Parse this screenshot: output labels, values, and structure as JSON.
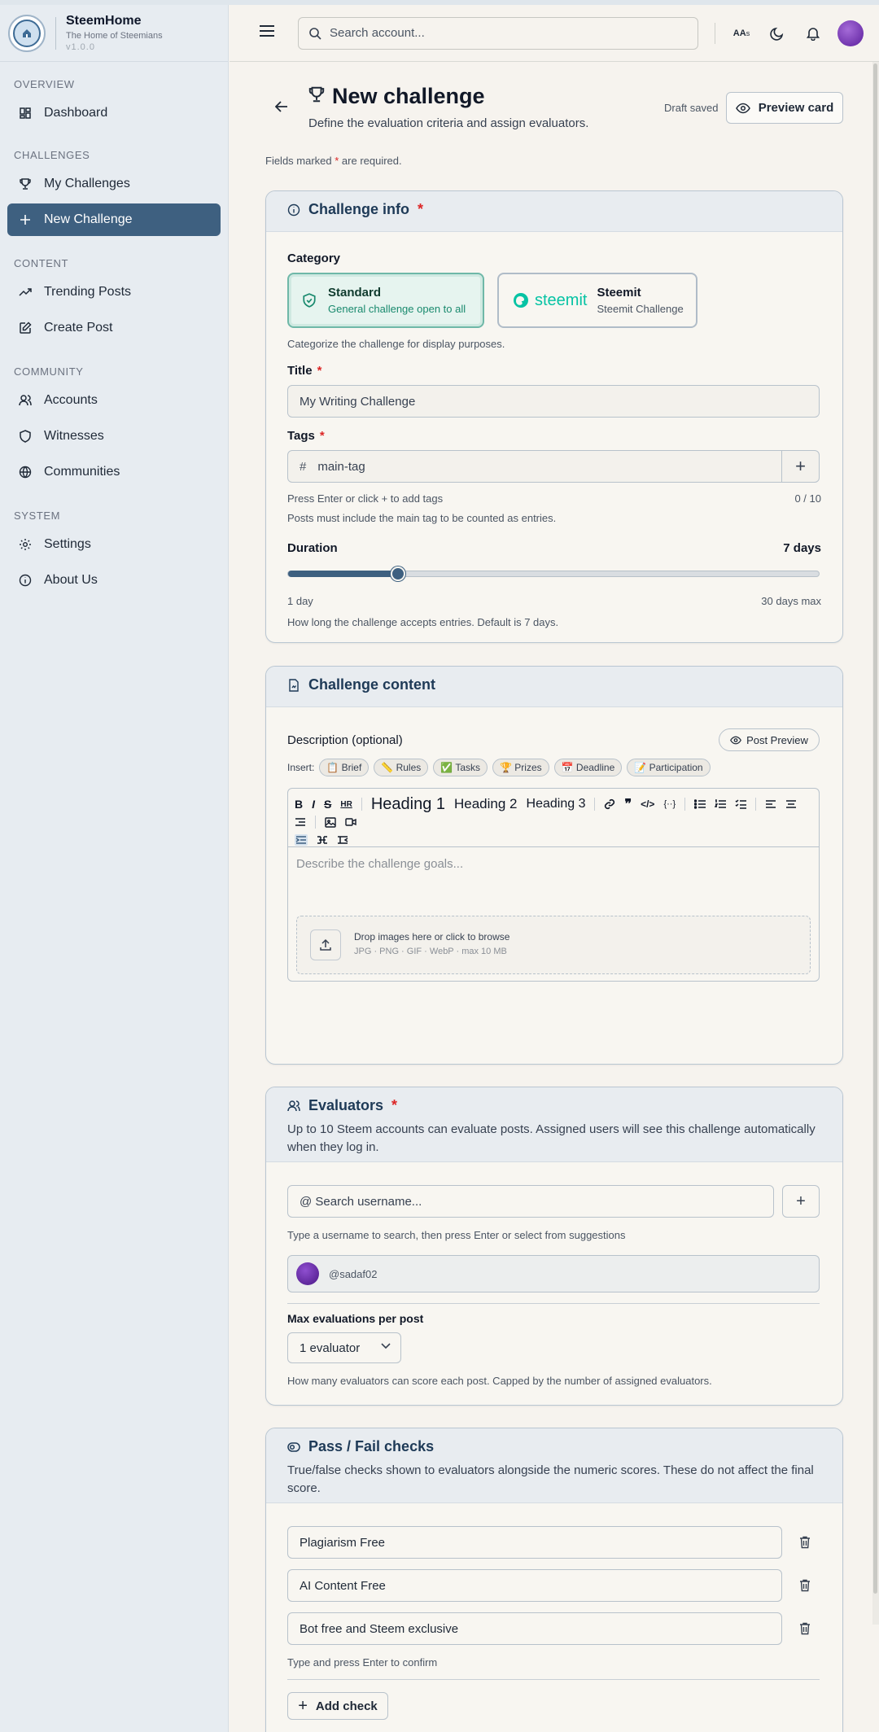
{
  "app": {
    "name": "SteemHome",
    "tagline": "The Home of Steemians",
    "version": "v1.0.0"
  },
  "sidebar": {
    "sections": [
      {
        "title": "OVERVIEW",
        "items": [
          {
            "label": "Dashboard",
            "icon": "dashboard-icon"
          }
        ]
      },
      {
        "title": "CHALLENGES",
        "items": [
          {
            "label": "My Challenges",
            "icon": "trophy-icon"
          },
          {
            "label": "New Challenge",
            "icon": "plus-icon",
            "active": true
          }
        ]
      },
      {
        "title": "CONTENT",
        "items": [
          {
            "label": "Trending Posts",
            "icon": "trending-icon"
          },
          {
            "label": "Create Post",
            "icon": "edit-icon"
          }
        ]
      },
      {
        "title": "COMMUNITY",
        "items": [
          {
            "label": "Accounts",
            "icon": "users-icon"
          },
          {
            "label": "Witnesses",
            "icon": "shield-icon"
          },
          {
            "label": "Communities",
            "icon": "globe-icon"
          }
        ]
      },
      {
        "title": "SYSTEM",
        "items": [
          {
            "label": "Settings",
            "icon": "gear-icon"
          },
          {
            "label": "About Us",
            "icon": "info-icon"
          }
        ]
      }
    ]
  },
  "topbar": {
    "search_placeholder": "Search account...",
    "font_size_label": "AA",
    "font_size_sub": "s"
  },
  "page": {
    "title": "New challenge",
    "subtitle": "Define the evaluation criteria and assign evaluators.",
    "draft_status": "Draft saved",
    "preview_label": "Preview card",
    "required_note_prefix": "Fields marked ",
    "required_note_star": "*",
    "required_note_suffix": " are required."
  },
  "challenge_info": {
    "heading": "Challenge info",
    "category_label": "Category",
    "categories": [
      {
        "title": "Standard",
        "desc": "General challenge open to all",
        "selected": true
      },
      {
        "title": "Steemit",
        "desc": "Steemit Challenge",
        "logo_text": "steemit",
        "selected": false
      }
    ],
    "category_hint": "Categorize the challenge for display purposes.",
    "title_label": "Title",
    "title_placeholder": "My Writing Challenge",
    "tags_label": "Tags",
    "tags_hash": "#",
    "tags_placeholder": "main-tag",
    "tags_plus": "+",
    "tags_hint": "Press Enter or click + to add tags",
    "tags_count": "0 / 10",
    "tags_note": "Posts must include the main tag to be counted as entries.",
    "duration_label": "Duration",
    "duration_value": "7 days",
    "duration_days": 7,
    "duration_min": 1,
    "duration_max": 30,
    "duration_min_label": "1 day",
    "duration_max_label": "30 days max",
    "duration_hint": "How long the challenge accepts entries. Default is 7 days."
  },
  "challenge_content": {
    "heading": "Challenge content",
    "description_label": "Description (optional)",
    "post_preview_label": "Post Preview",
    "insert_label": "Insert:",
    "insert_chips": [
      "📋 Brief",
      "📏 Rules",
      "✅ Tasks",
      "🏆 Prizes",
      "📅 Deadline",
      "📝 Participation"
    ],
    "toolbar": {
      "bold": "B",
      "italic": "I",
      "strike": "S",
      "code_inline": "HR",
      "h1": "Heading 1",
      "h2": "Heading 2",
      "h3": "Heading 3"
    },
    "editor_placeholder": "Describe the challenge goals...",
    "drop_title": "Drop images here or click to browse",
    "drop_sub": "JPG · PNG · GIF · WebP · max 10 MB"
  },
  "evaluators": {
    "heading": "Evaluators",
    "description": "Up to 10 Steem accounts can evaluate posts. Assigned users will see this challenge automatically when they log in.",
    "search_placeholder": "@ Search username...",
    "add_label": "+",
    "search_hint": "Type a username to search, then press Enter or select from suggestions",
    "assigned": [
      {
        "username": "@sadaf02"
      }
    ],
    "max_label": "Max evaluations per post",
    "max_value": "1 evaluator",
    "max_hint": "How many evaluators can score each post. Capped by the number of assigned evaluators."
  },
  "pass_fail": {
    "heading": "Pass / Fail checks",
    "description": "True/false checks shown to evaluators alongside the numeric scores. These do not affect the final score.",
    "checks": [
      "Plagiarism Free",
      "AI Content Free",
      "Bot free and Steem exclusive"
    ],
    "hint": "Type and press Enter to confirm",
    "add_label": "Add check",
    "add_plus": "+"
  },
  "colors": {
    "accent": "#3e6080",
    "required": "#dc2626",
    "steemit": "#06c3a4"
  }
}
